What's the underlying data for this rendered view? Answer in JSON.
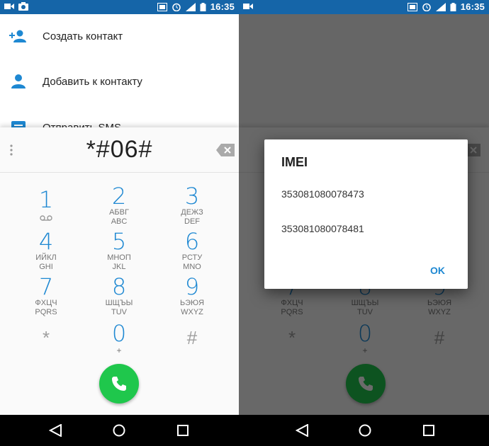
{
  "status_bar": {
    "time": "16:35"
  },
  "contact_actions": [
    {
      "label": "Создать контакт",
      "icon": "add-person-icon"
    },
    {
      "label": "Добавить к контакту",
      "icon": "person-icon"
    },
    {
      "label": "Отправить SMS",
      "icon": "message-icon"
    }
  ],
  "dialer": {
    "digits": "*#06#",
    "keys": [
      {
        "num": "1",
        "l1": "",
        "l2": ""
      },
      {
        "num": "2",
        "l1": "АБВГ",
        "l2": "ABC"
      },
      {
        "num": "3",
        "l1": "ДЕЖЗ",
        "l2": "DEF"
      },
      {
        "num": "4",
        "l1": "ИЙКЛ",
        "l2": "GHI"
      },
      {
        "num": "5",
        "l1": "МНОП",
        "l2": "JKL"
      },
      {
        "num": "6",
        "l1": "РСТУ",
        "l2": "MNO"
      },
      {
        "num": "7",
        "l1": "ФХЦЧ",
        "l2": "PQRS"
      },
      {
        "num": "8",
        "l1": "ШЩЪЫ",
        "l2": "TUV"
      },
      {
        "num": "9",
        "l1": "ЬЭЮЯ",
        "l2": "WXYZ"
      },
      {
        "num": "*",
        "l1": "",
        "l2": ""
      },
      {
        "num": "0",
        "l1": "+",
        "l2": ""
      },
      {
        "num": "#",
        "l1": "",
        "l2": ""
      }
    ]
  },
  "imei_dialog": {
    "title": "IMEI",
    "imei_1": "353081080078473",
    "imei_2": "353081080078481",
    "ok_label": "OK"
  },
  "colors": {
    "status_bar": "#1565a8",
    "accent": "#1e88d2",
    "call_button": "#1fc74c"
  }
}
